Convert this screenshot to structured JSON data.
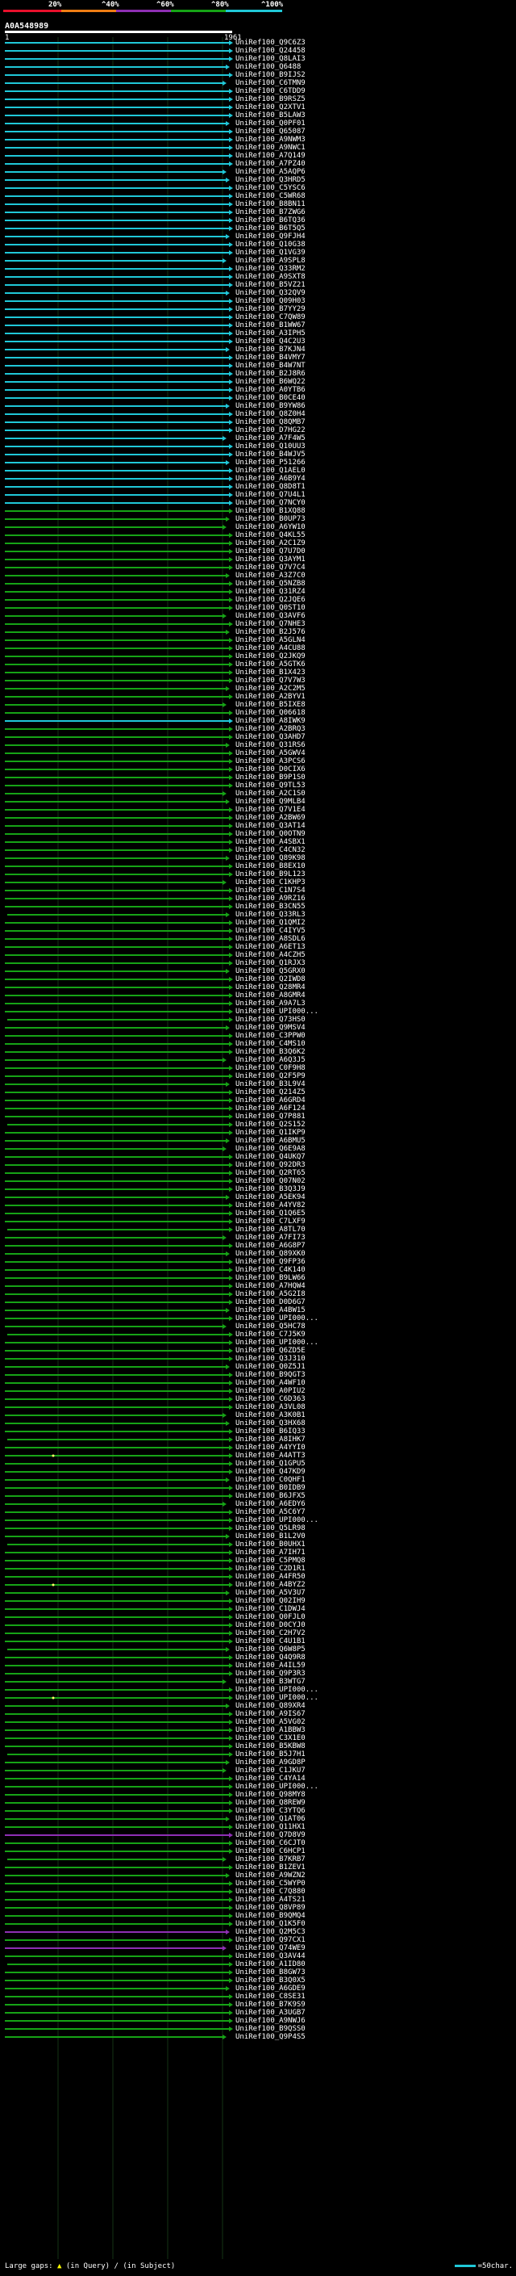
{
  "legend": {
    "labels": [
      "20%",
      "^40%",
      "^60%",
      "^80%",
      "^100%"
    ],
    "colors": [
      "#e8102c",
      "#ef7d14",
      "#8e2fb3",
      "#16a316",
      "#20c8d8"
    ]
  },
  "query": {
    "id": "A0A548989",
    "start_tick": "1",
    "end_tick": "1961"
  },
  "hits": [
    {
      "label": "UniRef100_Q9C6Z3",
      "c": "cyan"
    },
    {
      "label": "UniRef100_Q24458",
      "c": "cyan"
    },
    {
      "label": "UniRef100_Q8LAI3",
      "c": "cyan"
    },
    {
      "label": "UniRef100_Q6488",
      "c": "cyan"
    },
    {
      "label": "UniRef100_B9IJS2",
      "c": "cyan"
    },
    {
      "label": "UniRef100_C6TMN9",
      "c": "cyan"
    },
    {
      "label": "UniRef100_C6TDD9",
      "c": "cyan"
    },
    {
      "label": "UniRef100_B9RSZ5",
      "c": "cyan"
    },
    {
      "label": "UniRef100_Q2XTV1",
      "c": "cyan"
    },
    {
      "label": "UniRef100_B5LAW3",
      "c": "cyan"
    },
    {
      "label": "UniRef100_Q0PF01",
      "c": "cyan"
    },
    {
      "label": "UniRef100_Q65087",
      "c": "cyan"
    },
    {
      "label": "UniRef100_A9NWM3",
      "c": "cyan"
    },
    {
      "label": "UniRef100_A9NWC1",
      "c": "cyan"
    },
    {
      "label": "UniRef100_A7Q149",
      "c": "cyan"
    },
    {
      "label": "UniRef100_A7PZ40",
      "c": "cyan"
    },
    {
      "label": "UniRef100_A5AQP6",
      "c": "cyan"
    },
    {
      "label": "UniRef100_Q3HRD5",
      "c": "cyan"
    },
    {
      "label": "UniRef100_C5YSC6",
      "c": "cyan"
    },
    {
      "label": "UniRef100_C5WR68",
      "c": "cyan"
    },
    {
      "label": "UniRef100_B8BN11",
      "c": "cyan"
    },
    {
      "label": "UniRef100_B7ZWG6",
      "c": "cyan"
    },
    {
      "label": "UniRef100_B6TQ36",
      "c": "cyan"
    },
    {
      "label": "UniRef100_B6T5Q5",
      "c": "cyan"
    },
    {
      "label": "UniRef100_Q9FJH4",
      "c": "cyan"
    },
    {
      "label": "UniRef100_Q10G38",
      "c": "cyan"
    },
    {
      "label": "UniRef100_Q1VG39",
      "c": "cyan"
    },
    {
      "label": "UniRef100_A9SPL8",
      "c": "cyan"
    },
    {
      "label": "UniRef100_Q33RM2",
      "c": "cyan"
    },
    {
      "label": "UniRef100_A9SXT8",
      "c": "cyan"
    },
    {
      "label": "UniRef100_B5VZ21",
      "c": "cyan"
    },
    {
      "label": "UniRef100_Q32QV9",
      "c": "cyan"
    },
    {
      "label": "UniRef100_Q09H03",
      "c": "cyan"
    },
    {
      "label": "UniRef100_B7YY29",
      "c": "cyan"
    },
    {
      "label": "UniRef100_C7QW89",
      "c": "cyan"
    },
    {
      "label": "UniRef100_B1WW67",
      "c": "cyan"
    },
    {
      "label": "UniRef100_A3IPH5",
      "c": "cyan"
    },
    {
      "label": "UniRef100_Q4C2U3",
      "c": "cyan"
    },
    {
      "label": "UniRef100_B7KJN4",
      "c": "cyan"
    },
    {
      "label": "UniRef100_B4VMY7",
      "c": "cyan"
    },
    {
      "label": "UniRef100_B4W7NT",
      "c": "cyan"
    },
    {
      "label": "UniRef100_B2J8R6",
      "c": "cyan"
    },
    {
      "label": "UniRef100_B6WQ22",
      "c": "cyan"
    },
    {
      "label": "UniRef100_A0YTB6",
      "c": "cyan"
    },
    {
      "label": "UniRef100_B0CE40",
      "c": "cyan"
    },
    {
      "label": "UniRef100_B9YW86",
      "c": "cyan"
    },
    {
      "label": "UniRef100_Q8Z0H4",
      "c": "cyan"
    },
    {
      "label": "UniRef100_Q8QMB7",
      "c": "cyan"
    },
    {
      "label": "UniRef100_D7HG22",
      "c": "cyan"
    },
    {
      "label": "UniRef100_A7F4W5",
      "c": "cyan"
    },
    {
      "label": "UniRef100_Q10UU3",
      "c": "cyan"
    },
    {
      "label": "UniRef100_B4WJV5",
      "c": "cyan"
    },
    {
      "label": "UniRef100_P51266",
      "c": "cyan"
    },
    {
      "label": "UniRef100_Q1AEL0",
      "c": "cyan"
    },
    {
      "label": "UniRef100_A6B9Y4",
      "c": "cyan"
    },
    {
      "label": "UniRef100_Q8D8T1",
      "c": "cyan"
    },
    {
      "label": "UniRef100_Q7U4L1",
      "c": "cyan"
    },
    {
      "label": "UniRef100_Q7NCY0",
      "c": "cyan"
    },
    {
      "label": "UniRef100_B1XQ88",
      "c": "green"
    },
    {
      "label": "UniRef100_B0UP73",
      "c": "green"
    },
    {
      "label": "UniRef100_A6YW10",
      "c": "green"
    },
    {
      "label": "UniRef100_Q4KL55",
      "c": "green"
    },
    {
      "label": "UniRef100_A2C1Z9",
      "c": "green"
    },
    {
      "label": "UniRef100_Q7U7D0",
      "c": "green"
    },
    {
      "label": "UniRef100_Q3AYM1",
      "c": "green"
    },
    {
      "label": "UniRef100_Q7V7C4",
      "c": "green"
    },
    {
      "label": "UniRef100_A3Z7C0",
      "c": "green"
    },
    {
      "label": "UniRef100_Q5NZB8",
      "c": "green"
    },
    {
      "label": "UniRef100_Q31RZ4",
      "c": "green"
    },
    {
      "label": "UniRef100_Q2JQE6",
      "c": "green"
    },
    {
      "label": "UniRef100_Q0ST10",
      "c": "green"
    },
    {
      "label": "UniRef100_Q3AVF6",
      "c": "green"
    },
    {
      "label": "UniRef100_Q7NHE3",
      "c": "green"
    },
    {
      "label": "UniRef100_B2J576",
      "c": "green"
    },
    {
      "label": "UniRef100_A5GLN4",
      "c": "green"
    },
    {
      "label": "UniRef100_A4CU88",
      "c": "green"
    },
    {
      "label": "UniRef100_Q2JKQ9",
      "c": "green"
    },
    {
      "label": "UniRef100_A5GTK6",
      "c": "green"
    },
    {
      "label": "UniRef100_B1X423",
      "c": "green"
    },
    {
      "label": "UniRef100_Q7V7W3",
      "c": "green"
    },
    {
      "label": "UniRef100_A2C2M5",
      "c": "green"
    },
    {
      "label": "UniRef100_A2BYV1",
      "c": "green"
    },
    {
      "label": "UniRef100_B5IXE8",
      "c": "green"
    },
    {
      "label": "UniRef100_Q06618",
      "c": "green"
    },
    {
      "label": "UniRef100_A8IWK9",
      "c": "cyan"
    },
    {
      "label": "UniRef100_A2BRQ3",
      "c": "green"
    },
    {
      "label": "UniRef100_Q3AHD7",
      "c": "green"
    },
    {
      "label": "UniRef100_Q31RS6",
      "c": "green"
    },
    {
      "label": "UniRef100_A5GWV4",
      "c": "green"
    },
    {
      "label": "UniRef100_A3PCS6",
      "c": "green"
    },
    {
      "label": "UniRef100_D0CIX6",
      "c": "green"
    },
    {
      "label": "UniRef100_B9P1S0",
      "c": "green"
    },
    {
      "label": "UniRef100_Q9TL53",
      "c": "green"
    },
    {
      "label": "UniRef100_A2C1S0",
      "c": "green"
    },
    {
      "label": "UniRef100_Q9MLB4",
      "c": "green"
    },
    {
      "label": "UniRef100_Q7V1E4",
      "c": "green"
    },
    {
      "label": "UniRef100_A2BW69",
      "c": "green"
    },
    {
      "label": "UniRef100_Q3AT14",
      "c": "green"
    },
    {
      "label": "UniRef100_Q0OTN9",
      "c": "green"
    },
    {
      "label": "UniRef100_A4SBX1",
      "c": "green"
    },
    {
      "label": "UniRef100_C4CN32",
      "c": "green"
    },
    {
      "label": "UniRef100_Q89K98",
      "c": "green"
    },
    {
      "label": "UniRef100_B8EX10",
      "c": "green"
    },
    {
      "label": "UniRef100_B9L123",
      "c": "green"
    },
    {
      "label": "UniRef100_C1KHP3",
      "c": "green"
    },
    {
      "label": "UniRef100_C1N7S4",
      "c": "green"
    },
    {
      "label": "UniRef100_A9RZ16",
      "c": "green"
    },
    {
      "label": "UniRef100_B3CN55",
      "c": "green"
    },
    {
      "label": "UniRef100_Q33RL3",
      "c": "green"
    },
    {
      "label": "UniRef100_Q1QMI2",
      "c": "green"
    },
    {
      "label": "UniRef100_C4IYV5",
      "c": "green"
    },
    {
      "label": "UniRef100_A8SDL6",
      "c": "green"
    },
    {
      "label": "UniRef100_A6ET13",
      "c": "green"
    },
    {
      "label": "UniRef100_A4CZH5",
      "c": "green"
    },
    {
      "label": "UniRef100_Q1RJX3",
      "c": "green"
    },
    {
      "label": "UniRef100_Q5GRX0",
      "c": "green"
    },
    {
      "label": "UniRef100_Q2IWD8",
      "c": "green"
    },
    {
      "label": "UniRef100_Q28MR4",
      "c": "green"
    },
    {
      "label": "UniRef100_A8GMR4",
      "c": "green"
    },
    {
      "label": "UniRef100_A9A7L3",
      "c": "green"
    },
    {
      "label": "UniRef100_UPI000...",
      "c": "green"
    },
    {
      "label": "UniRef100_Q73HS0",
      "c": "green"
    },
    {
      "label": "UniRef100_Q9MSV4",
      "c": "green"
    },
    {
      "label": "UniRef100_C3PPW0",
      "c": "green"
    },
    {
      "label": "UniRef100_C4MS10",
      "c": "green"
    },
    {
      "label": "UniRef100_B3Q6K2",
      "c": "green"
    },
    {
      "label": "UniRef100_A6Q3J5",
      "c": "green"
    },
    {
      "label": "UniRef100_C0F9H8",
      "c": "green"
    },
    {
      "label": "UniRef100_Q2F5P9",
      "c": "green"
    },
    {
      "label": "UniRef100_B3L9V4",
      "c": "green"
    },
    {
      "label": "UniRef100_Q214Z5",
      "c": "green"
    },
    {
      "label": "UniRef100_A6GRD4",
      "c": "green"
    },
    {
      "label": "UniRef100_A6F124",
      "c": "green"
    },
    {
      "label": "UniRef100_Q7P881",
      "c": "green"
    },
    {
      "label": "UniRef100_Q2S152",
      "c": "green"
    },
    {
      "label": "UniRef100_Q1IKP9",
      "c": "green"
    },
    {
      "label": "UniRef100_A6BMU5",
      "c": "green"
    },
    {
      "label": "UniRef100_Q6E9A8",
      "c": "green"
    },
    {
      "label": "UniRef100_Q4UKQ7",
      "c": "green"
    },
    {
      "label": "UniRef100_Q92DR3",
      "c": "green"
    },
    {
      "label": "UniRef100_Q2RT65",
      "c": "green"
    },
    {
      "label": "UniRef100_Q07N02",
      "c": "green"
    },
    {
      "label": "UniRef100_B3Q3J9",
      "c": "green"
    },
    {
      "label": "UniRef100_A5EK94",
      "c": "green"
    },
    {
      "label": "UniRef100_A4YV82",
      "c": "green"
    },
    {
      "label": "UniRef100_Q1Q6E5",
      "c": "green"
    },
    {
      "label": "UniRef100_C7LXF9",
      "c": "green"
    },
    {
      "label": "UniRef100_A8TL70",
      "c": "green"
    },
    {
      "label": "UniRef100_A7FI73",
      "c": "green"
    },
    {
      "label": "UniRef100_A6G8P7",
      "c": "green"
    },
    {
      "label": "UniRef100_Q89XK0",
      "c": "green"
    },
    {
      "label": "UniRef100_Q9FP36",
      "c": "green"
    },
    {
      "label": "UniRef100_C4K140",
      "c": "green"
    },
    {
      "label": "UniRef100_B9LW66",
      "c": "green"
    },
    {
      "label": "UniRef100_A7HQW4",
      "c": "green"
    },
    {
      "label": "UniRef100_A5G2I8",
      "c": "green"
    },
    {
      "label": "UniRef100_D0D6G7",
      "c": "green"
    },
    {
      "label": "UniRef100_A4BW15",
      "c": "green"
    },
    {
      "label": "UniRef100_UPI000...",
      "c": "green"
    },
    {
      "label": "UniRef100_Q5HC78",
      "c": "green"
    },
    {
      "label": "UniRef100_C7J5K9",
      "c": "green"
    },
    {
      "label": "UniRef100_UPI000...",
      "c": "green"
    },
    {
      "label": "UniRef100_Q6ZD5E",
      "c": "green"
    },
    {
      "label": "UniRef100_Q3J310",
      "c": "green"
    },
    {
      "label": "UniRef100_Q0Z5J1",
      "c": "green"
    },
    {
      "label": "UniRef100_B9QGT3",
      "c": "green"
    },
    {
      "label": "UniRef100_A4WF10",
      "c": "green"
    },
    {
      "label": "UniRef100_A0PIU2",
      "c": "green"
    },
    {
      "label": "UniRef100_C6D363",
      "c": "green"
    },
    {
      "label": "UniRef100_A3VL08",
      "c": "green"
    },
    {
      "label": "UniRef100_A3K0B1",
      "c": "green"
    },
    {
      "label": "UniRef100_Q3HX68",
      "c": "green"
    },
    {
      "label": "UniRef100_B6IQ33",
      "c": "green"
    },
    {
      "label": "UniRef100_A8IHK7",
      "c": "green"
    },
    {
      "label": "UniRef100_A4YYI0",
      "c": "green"
    },
    {
      "label": "UniRef100_A4ATT3",
      "c": "green"
    },
    {
      "label": "UniRef100_Q1GPU5",
      "c": "green"
    },
    {
      "label": "UniRef100_Q47KD9",
      "c": "green"
    },
    {
      "label": "UniRef100_C0QHF1",
      "c": "green"
    },
    {
      "label": "UniRef100_B0IDB9",
      "c": "green"
    },
    {
      "label": "UniRef100_B6JFX5",
      "c": "green"
    },
    {
      "label": "UniRef100_A6EDY6",
      "c": "green"
    },
    {
      "label": "UniRef100_A5C6Y7",
      "c": "green"
    },
    {
      "label": "UniRef100_UPI000...",
      "c": "green"
    },
    {
      "label": "UniRef100_Q5LR98",
      "c": "green"
    },
    {
      "label": "UniRef100_B1L2V0",
      "c": "green"
    },
    {
      "label": "UniRef100_B0UHX1",
      "c": "green"
    },
    {
      "label": "UniRef100_A7IH71",
      "c": "green"
    },
    {
      "label": "UniRef100_C5PMQ8",
      "c": "green"
    },
    {
      "label": "UniRef100_C2D1R1",
      "c": "green"
    },
    {
      "label": "UniRef100_A4FR50",
      "c": "green"
    },
    {
      "label": "UniRef100_A4BYZ2",
      "c": "green"
    },
    {
      "label": "UniRef100_A5V3U7",
      "c": "green"
    },
    {
      "label": "UniRef100_Q02IH9",
      "c": "green"
    },
    {
      "label": "UniRef100_C1DWJ4",
      "c": "green"
    },
    {
      "label": "UniRef100_Q0FJL0",
      "c": "green"
    },
    {
      "label": "UniRef100_D0CYJ0",
      "c": "green"
    },
    {
      "label": "UniRef100_C2H7V2",
      "c": "green"
    },
    {
      "label": "UniRef100_C4U1B1",
      "c": "green"
    },
    {
      "label": "UniRef100_Q6W8P5",
      "c": "green"
    },
    {
      "label": "UniRef100_Q4Q9R8",
      "c": "green"
    },
    {
      "label": "UniRef100_A4IL59",
      "c": "green"
    },
    {
      "label": "UniRef100_Q9P3R3",
      "c": "green"
    },
    {
      "label": "UniRef100_B3WTG7",
      "c": "green"
    },
    {
      "label": "UniRef100_UPI000...",
      "c": "green"
    },
    {
      "label": "UniRef100_UPI000...",
      "c": "green"
    },
    {
      "label": "UniRef100_Q89XR4",
      "c": "green"
    },
    {
      "label": "UniRef100_A9IS67",
      "c": "green"
    },
    {
      "label": "UniRef100_A5VG02",
      "c": "green"
    },
    {
      "label": "UniRef100_A1BBW3",
      "c": "green"
    },
    {
      "label": "UniRef100_C3X1E0",
      "c": "green"
    },
    {
      "label": "UniRef100_B5KBW8",
      "c": "green"
    },
    {
      "label": "UniRef100_B5J7H1",
      "c": "green"
    },
    {
      "label": "UniRef100_A9GD8P",
      "c": "green"
    },
    {
      "label": "UniRef100_C1JKU7",
      "c": "green"
    },
    {
      "label": "UniRef100_C4YA14",
      "c": "green"
    },
    {
      "label": "UniRef100_UPI000...",
      "c": "green"
    },
    {
      "label": "UniRef100_Q98MY8",
      "c": "green"
    },
    {
      "label": "UniRef100_Q8REW9",
      "c": "green"
    },
    {
      "label": "UniRef100_C3YTQ6",
      "c": "green"
    },
    {
      "label": "UniRef100_Q1AT06",
      "c": "green"
    },
    {
      "label": "UniRef100_Q11HX1",
      "c": "green"
    },
    {
      "label": "UniRef100_Q7D8V9",
      "c": "purple"
    },
    {
      "label": "UniRef100_C6CJT0",
      "c": "green"
    },
    {
      "label": "UniRef100_C6HCP1",
      "c": "green"
    },
    {
      "label": "UniRef100_B7KRB7",
      "c": "green"
    },
    {
      "label": "UniRef100_B1ZEV1",
      "c": "green"
    },
    {
      "label": "UniRef100_A9WZN2",
      "c": "green"
    },
    {
      "label": "UniRef100_C5WYP0",
      "c": "green"
    },
    {
      "label": "UniRef100_C7Q880",
      "c": "green"
    },
    {
      "label": "UniRef100_A4TS21",
      "c": "green"
    },
    {
      "label": "UniRef100_Q8VP89",
      "c": "green"
    },
    {
      "label": "UniRef100_B9QMQ4",
      "c": "green"
    },
    {
      "label": "UniRef100_Q1K5F0",
      "c": "green"
    },
    {
      "label": "UniRef100_Q2M5C3",
      "c": "purple"
    },
    {
      "label": "UniRef100_Q97CX1",
      "c": "green"
    },
    {
      "label": "UniRef100_Q74WE9",
      "c": "purple"
    },
    {
      "label": "UniRef100_Q3AV44",
      "c": "green"
    },
    {
      "label": "UniRef100_A1ID80",
      "c": "green"
    },
    {
      "label": "UniRef100_B8GW73",
      "c": "green"
    },
    {
      "label": "UniRef100_B3Q0X5",
      "c": "green"
    },
    {
      "label": "UniRef100_A6GDE9",
      "c": "green"
    },
    {
      "label": "UniRef100_C8SE31",
      "c": "green"
    },
    {
      "label": "UniRef100_B7K9S9",
      "c": "green"
    },
    {
      "label": "UniRef100_A3UGB7",
      "c": "green"
    },
    {
      "label": "UniRef100_A9NWJ6",
      "c": "green"
    },
    {
      "label": "UniRef100_B9QSS0",
      "c": "green"
    },
    {
      "label": "UniRef100_Q9P4S5",
      "c": "green"
    }
  ],
  "footer": {
    "large_gaps": "Large gaps:",
    "in_query": "(in Query)",
    "slash": "/",
    "in_subject": "(in Subject)",
    "scale": "=50char."
  }
}
